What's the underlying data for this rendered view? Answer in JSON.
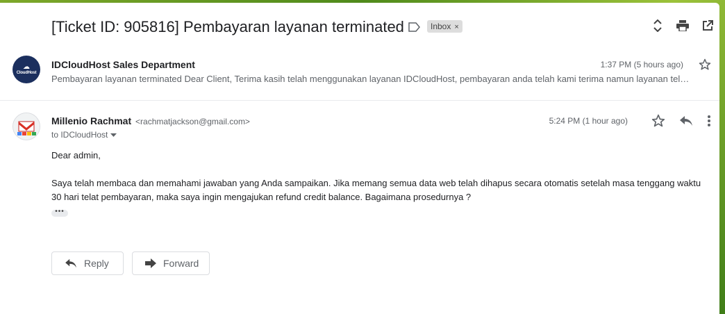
{
  "thread": {
    "subject": "[Ticket ID: 905816] Pembayaran layanan terminated",
    "label_chip": "Inbox",
    "label_chip_close": "×"
  },
  "message1": {
    "avatar_text": "CloudHost",
    "sender": "IDCloudHost Sales Department",
    "time": "1:37 PM (5 hours ago)",
    "snippet": "Pembayaran layanan terminated Dear Client, Terima kasih telah menggunakan layanan IDCloudHost, pembayaran anda telah kami terima namun layanan tel…"
  },
  "message2": {
    "sender": "Millenio Rachmat",
    "email": "<rachmatjackson@gmail.com>",
    "to": "to IDCloudHost",
    "time": "5:24 PM (1 hour ago)",
    "greeting": "Dear admin,",
    "body": "Saya telah membaca dan memahami jawaban yang Anda sampaikan. Jika memang semua data web telah dihapus secara otomatis setelah masa tenggang waktu 30 hari telat pembayaran, maka saya ingin mengajukan refund credit balance. Bagaimana prosedurnya ?",
    "ellipsis": "•••"
  },
  "actions": {
    "reply_label": "Reply",
    "forward_label": "Forward"
  },
  "icons": {
    "label": "label-outline-icon",
    "expand": "unfold-more-icon",
    "print": "print-icon",
    "open_new_window": "open-in-new-icon",
    "star": "star-outline-icon",
    "reply": "reply-icon",
    "more": "more-vert-icon",
    "forward": "forward-icon"
  }
}
